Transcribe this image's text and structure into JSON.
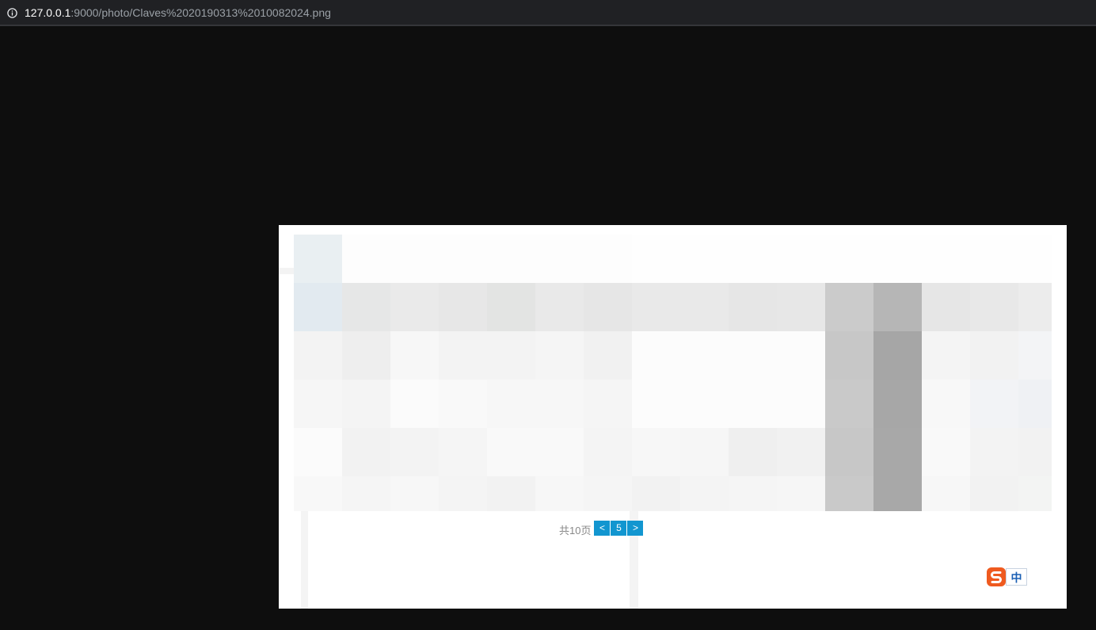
{
  "browser": {
    "url_host": "127.0.0.1",
    "url_rest": ":9000/photo/Claves%2020190313%2010082024.png",
    "info_icon": "info-circle-icon"
  },
  "photo": {
    "pager": {
      "total_label": "共10页",
      "prev_label": "<",
      "page_label": "5",
      "next_label": ">"
    },
    "ime": {
      "logo_icon": "sogou-s-icon",
      "mode_label": "中"
    },
    "colors": {
      "page_button": "#1296d0",
      "background": "#0e0e0e"
    }
  }
}
